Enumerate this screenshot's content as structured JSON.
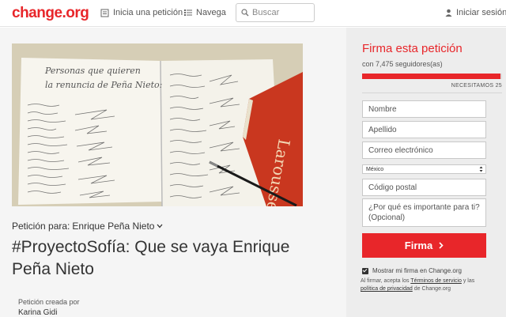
{
  "header": {
    "logo": "change.org",
    "start_petition": "Inicia una petición",
    "browse": "Navega",
    "search_placeholder": "Buscar",
    "login": "Iniciar sesión"
  },
  "petition": {
    "recipient_label": "Petición para:",
    "recipient_name": "Enrique Peña Nieto",
    "title": "#ProyectoSofía: Que se vaya Enrique Peña Nieto",
    "created_by_label": "Petición creada por",
    "creator_name": "Karina Gidi",
    "image": {
      "heading_line1": "Personas que quieren",
      "heading_line2": "la renuncia de Peña Nieto:",
      "book_text": "Larousse"
    }
  },
  "sign": {
    "title": "Firma esta petición",
    "supporters": "con 7,475 seguidores(as)",
    "progress_fraction": 0.99,
    "needed": "NECESITAMOS 25",
    "fields": {
      "first_name": "Nombre",
      "last_name": "Apellido",
      "email": "Correo electrónico",
      "country": "México",
      "postal": "Código postal",
      "reason": "¿Por qué es importante para ti? (Opcional)"
    },
    "submit": "Firma",
    "show_signature": "Mostrar mi firma en Change.org",
    "legal_prefix": "Al firmar, acepta los",
    "terms_link": "Términos de servicio",
    "legal_mid": "y las",
    "privacy_link": "política de privacidad",
    "legal_suffix": "de Change.org"
  },
  "colors": {
    "brand_red": "#e8262a",
    "sidebar_bg": "#ededed",
    "main_bg": "#f5f5f5"
  }
}
